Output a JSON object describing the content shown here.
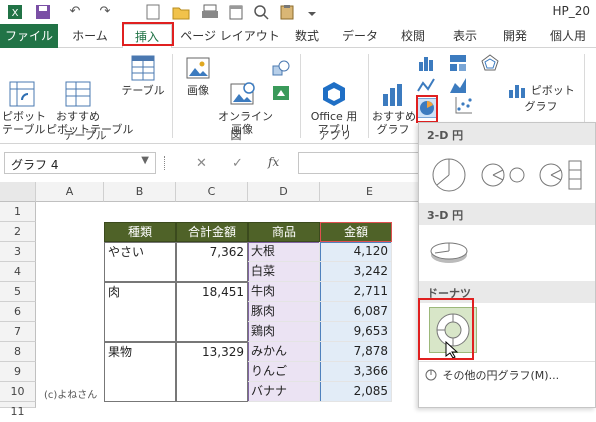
{
  "app": {
    "title": "HP_20"
  },
  "qat": {
    "undo_glyph": "↶",
    "redo_glyph": "↷"
  },
  "tabs": [
    "ファイル",
    "ホーム",
    "挿入",
    "ページ レイアウト",
    "数式",
    "データ",
    "校閲",
    "表示",
    "開発",
    "個人用"
  ],
  "ribbon": {
    "pivot": "ピボット\nテーブル",
    "rec_pivot": "おすすめ\nピボットテーブル",
    "table": "テーブル",
    "group_table": "テーブル",
    "image": "画像",
    "online_image": "オンライン\n画像",
    "group_fig": "図",
    "office_app": "Office 用\nアプリ",
    "group_app": "アプリ",
    "rec_chart": "おすすめ\nグラフ",
    "pivot_chart": "ピボットグラフ"
  },
  "namebox": {
    "value": "グラフ 4",
    "cancel": "✕",
    "enter": "✓",
    "fx": "fx"
  },
  "columns": [
    "A",
    "B",
    "C",
    "D",
    "E"
  ],
  "rows": [
    "1",
    "2",
    "3",
    "4",
    "5",
    "6",
    "7",
    "8",
    "9",
    "10",
    "11"
  ],
  "table": {
    "headers": [
      "種類",
      "合計金額",
      "商品",
      "金額"
    ],
    "groups": [
      {
        "type": "やさい",
        "total": "7,362"
      },
      {
        "type": "肉",
        "total": "18,451"
      },
      {
        "type": "果物",
        "total": "13,329"
      }
    ],
    "items": [
      {
        "name": "大根",
        "amount": "4,120"
      },
      {
        "name": "白菜",
        "amount": "3,242"
      },
      {
        "name": "牛肉",
        "amount": "2,711"
      },
      {
        "name": "豚肉",
        "amount": "6,087"
      },
      {
        "name": "鶏肉",
        "amount": "9,653"
      },
      {
        "name": "みかん",
        "amount": "7,878"
      },
      {
        "name": "りんご",
        "amount": "3,366"
      },
      {
        "name": "バナナ",
        "amount": "2,085"
      }
    ]
  },
  "watermark": "(c)よねさん",
  "gallery": {
    "section_2d": "2-D 円",
    "section_3d": "3-D 円",
    "section_donut": "ドーナツ",
    "more": "その他の円グラフ(M)..."
  },
  "colors": {
    "accent": "#217346",
    "header_fill": "#4f6228",
    "highlight": "#e02020"
  }
}
